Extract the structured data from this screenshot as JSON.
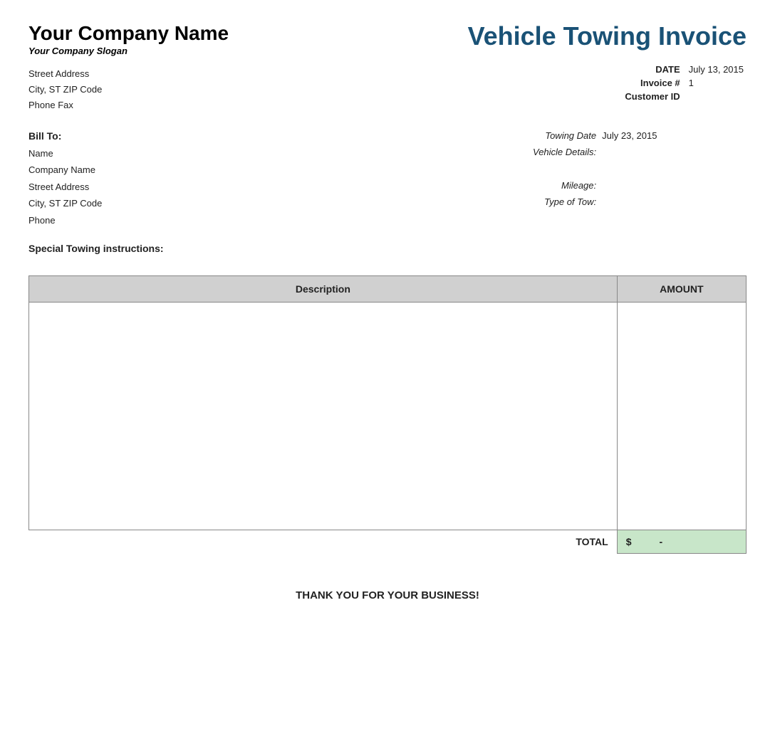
{
  "company": {
    "name": "Your Company Name",
    "slogan": "Your Company Slogan",
    "street": "Street Address",
    "city_state_zip": "City, ST  ZIP Code",
    "phone_fax": "Phone    Fax"
  },
  "invoice": {
    "title": "Vehicle Towing Invoice",
    "date_label": "DATE",
    "date_value": "July 13, 2015",
    "invoice_num_label": "Invoice #",
    "invoice_num_value": "1",
    "customer_id_label": "Customer ID",
    "customer_id_value": ""
  },
  "bill_to": {
    "label": "Bill To:",
    "name": "Name",
    "company": "Company Name",
    "street": "Street Address",
    "city_state_zip": "City, ST  ZIP Code",
    "phone": "Phone"
  },
  "towing": {
    "date_label": "Towing Date",
    "date_value": "July 23, 2015",
    "vehicle_label": "Vehicle Details:",
    "vehicle_value": "",
    "mileage_label": "Mileage:",
    "mileage_value": "",
    "type_label": "Type of Tow:",
    "type_value": ""
  },
  "special_instructions": {
    "label": "Special Towing instructions:"
  },
  "table": {
    "desc_header": "Description",
    "amt_header": "AMOUNT",
    "total_label": "TOTAL",
    "total_value": "$",
    "total_dash": "-"
  },
  "footer": {
    "thank_you": "THANK YOU FOR YOUR BUSINESS!"
  }
}
